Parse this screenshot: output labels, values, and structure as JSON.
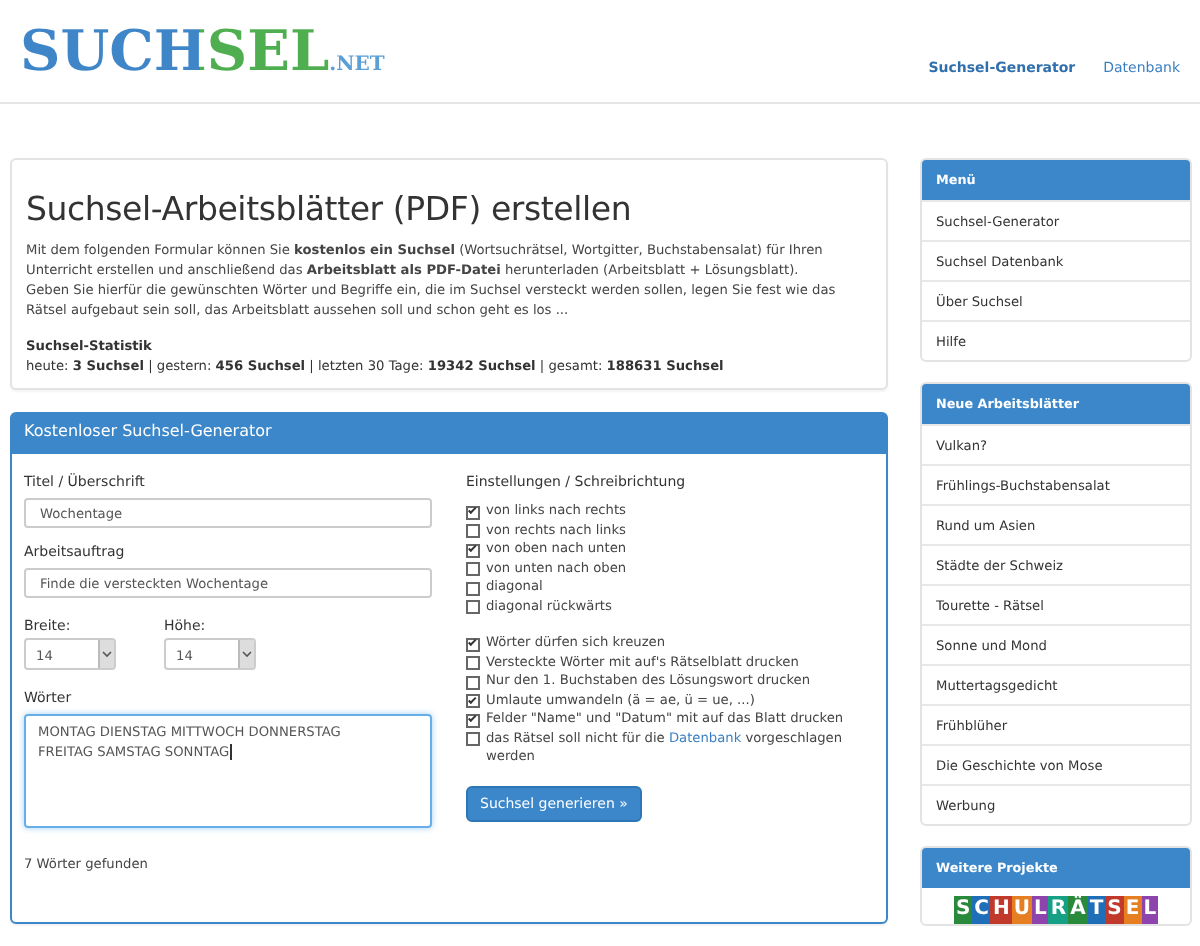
{
  "header": {
    "logo": {
      "main": "SUCHSEL",
      "suffix": ".NET"
    },
    "nav": [
      {
        "label": "Suchsel-Generator",
        "selected": true
      },
      {
        "label": "Datenbank",
        "selected": false
      }
    ]
  },
  "intro": {
    "title": "Suchsel-Arbeitsblätter (PDF) erstellen",
    "paragraphs": [
      "Mit dem folgenden Formular können Sie **kostenlos ein Suchsel** (Wortsuchrätsel, Wortgitter, Buchstabensalat) für Ihren Unterricht erstellen und anschließend das **Arbeitsblatt als PDF-Datei** herunterladen (Arbeitsblatt + Lösungsblatt).",
      "Geben Sie hierfür die gewünschten Wörter und Begriffe ein, die im Suchsel versteckt werden sollen, legen Sie fest wie das Rätsel aufgebaut sein soll, das Arbeitsblatt aussehen soll und schon geht es los ..."
    ],
    "stats_title": "Suchsel-Statistik",
    "stats": "heute: **3 Suchsel** | gestern: **456 Suchsel** | letzten 30 Tage: **19342 Suchsel** | gesamt: **188631 Suchsel**"
  },
  "generator": {
    "title": "Kostenloser Suchsel-Generator",
    "fields": [
      {
        "label": "Titel / Überschrift",
        "value": "Wochentage"
      },
      {
        "label": "Arbeitsauftrag",
        "value": "Finde die versteckten Wochentage"
      }
    ],
    "size": [
      {
        "label": "Breite:",
        "value": "14"
      },
      {
        "label": "Höhe:",
        "value": "14"
      }
    ],
    "words": {
      "label": "Wörter",
      "value": "MONTAG DIENSTAG MITTWOCH DONNERSTAG FREITAG SAMSTAG SONNTAG"
    },
    "count": "7 Wörter gefunden",
    "settings_title": "Einstellungen / Schreibrichtung",
    "directions": [
      {
        "label": "von links nach rechts",
        "checked": true
      },
      {
        "label": "von rechts nach links",
        "checked": false
      },
      {
        "label": "von oben nach unten",
        "checked": true
      },
      {
        "label": "von unten nach oben",
        "checked": false
      },
      {
        "label": "diagonal",
        "checked": false
      },
      {
        "label": "diagonal rückwärts",
        "checked": false
      }
    ],
    "options": [
      {
        "label": "Wörter dürfen sich kreuzen",
        "checked": true
      },
      {
        "label": "Versteckte Wörter mit auf's Rätselblatt drucken",
        "checked": false
      },
      {
        "label": "Nur den 1. Buchstaben des Lösungswort drucken",
        "checked": false
      },
      {
        "label": "Umlaute umwandeln (ä = ae, ü = ue, ...)",
        "checked": true
      },
      {
        "label": "Felder \"Name\" und \"Datum\" mit auf das Blatt drucken",
        "checked": true
      },
      {
        "label": "das Rätsel soll nicht für die",
        "link": "Datenbank",
        "after": "vorgeschlagen werden",
        "checked": false
      }
    ],
    "submit": "Suchsel generieren »"
  },
  "sidebar": [
    {
      "title": "Menü",
      "items": [
        "Suchsel-Generator",
        "Suchsel Datenbank",
        "Über Suchsel",
        "Hilfe"
      ]
    },
    {
      "title": "Neue Arbeitsblätter",
      "items": [
        "Vulkan?",
        "Frühlings-Buchstabensalat",
        "Rund um Asien",
        "Städte der Schweiz",
        "Tourette - Rätsel",
        "Sonne und Mond",
        "Muttertagsgedicht",
        "Frühblüher",
        "Die Geschichte von Mose",
        "Werbung"
      ]
    },
    {
      "title": "Weitere Projekte",
      "banner": "SCHULRÄTSEL"
    }
  ]
}
